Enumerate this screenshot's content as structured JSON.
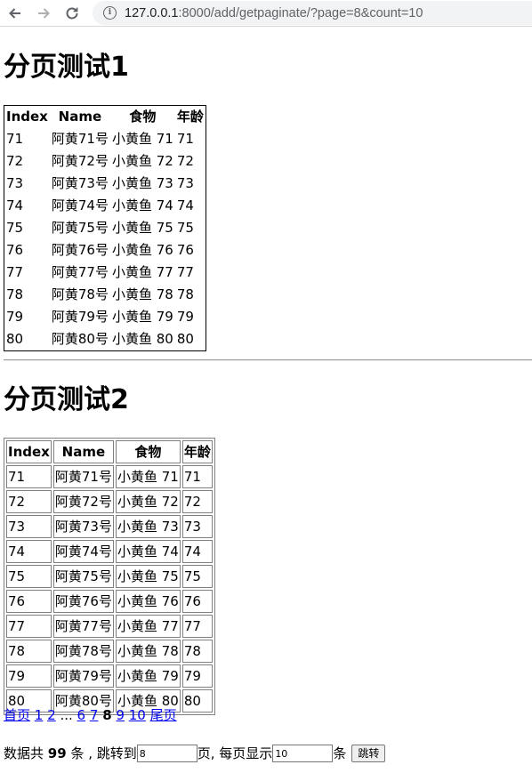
{
  "browser": {
    "url_host": "127.0.0.1",
    "url_path": ":8000/add/getpaginate/?page=8&count=10"
  },
  "section1": {
    "title": "分页测试1"
  },
  "section2": {
    "title": "分页测试2"
  },
  "table": {
    "headers": [
      "Index",
      "Name",
      "食物",
      "年龄"
    ],
    "rows": [
      [
        "71",
        "阿黄71号",
        "小黄鱼 71",
        "71"
      ],
      [
        "72",
        "阿黄72号",
        "小黄鱼 72",
        "72"
      ],
      [
        "73",
        "阿黄73号",
        "小黄鱼 73",
        "73"
      ],
      [
        "74",
        "阿黄74号",
        "小黄鱼 74",
        "74"
      ],
      [
        "75",
        "阿黄75号",
        "小黄鱼 75",
        "75"
      ],
      [
        "76",
        "阿黄76号",
        "小黄鱼 76",
        "76"
      ],
      [
        "77",
        "阿黄77号",
        "小黄鱼 77",
        "77"
      ],
      [
        "78",
        "阿黄78号",
        "小黄鱼 78",
        "78"
      ],
      [
        "79",
        "阿黄79号",
        "小黄鱼 79",
        "79"
      ],
      [
        "80",
        "阿黄80号",
        "小黄鱼 80",
        "80"
      ]
    ]
  },
  "pager": {
    "first": "首页",
    "p1": "1",
    "p2": "2",
    "ellipsis": "...",
    "p6": "6",
    "p7": "7",
    "current": "8",
    "p9": "9",
    "p10": "10",
    "last": "尾页"
  },
  "jump": {
    "total_prefix": "数据共",
    "total_count": "99",
    "total_suffix": "条 , 跳转到",
    "page_value": "8",
    "page_unit": "页, 每页显示",
    "count_value": "10",
    "count_unit": "条",
    "button": "跳转"
  },
  "colors": {
    "link": "#0000ee",
    "address_bar": "#f1f3f4"
  },
  "icons": {
    "back": "arrow-left-icon",
    "forward": "arrow-right-icon",
    "reload": "reload-icon",
    "info": "info-icon"
  }
}
